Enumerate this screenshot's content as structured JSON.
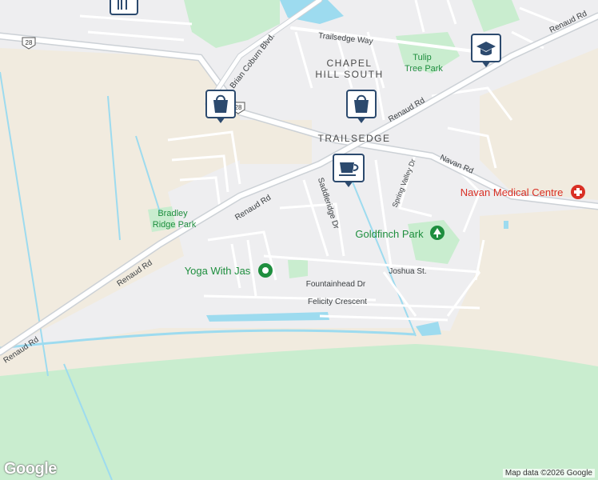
{
  "map": {
    "labels": {
      "neighbourhood_1": "CHAPEL",
      "neighbourhood_2": "HILL SOUTH",
      "trailsedge": "TRAILSEDGE",
      "trailsedge_way": "Trailsedge Way",
      "brian_coburn": "Brian Coburn Blvd.",
      "renaud_nw": "Renaud Rd",
      "renaud_center": "Renaud Rd",
      "renaud_mid": "Renaud Rd",
      "renaud_sw1": "Renaud Rd",
      "renaud_sw2": "Renaud Rd",
      "navan": "Navan Rd",
      "saddleridge": "Saddleridge Dr",
      "spring_valley": "Spring Valley Dr",
      "joshua": "Joshua St.",
      "fountainhead": "Fountainhead Dr",
      "felicity": "Felicity Crescent",
      "route_28_a": "28",
      "route_28_b": "28",
      "tulip_1": "Tulip",
      "tulip_2": "Tree Park",
      "bradley_1": "Bradley",
      "bradley_2": "Ridge Park",
      "goldfinch": "Goldfinch Park",
      "yoga": "Yoga With Jas",
      "navan_medical": "Navan Medical Centre"
    },
    "pins": {
      "restaurant": "restaurant-icon",
      "shopping_1": "shopping-bag-icon",
      "shopping_2": "shopping-bag-icon",
      "cafe": "coffee-cup-icon",
      "school": "school-icon"
    },
    "colors": {
      "water": "#9ddbef",
      "park": "#c9edcf",
      "park_label": "#1e8e3e",
      "medical": "#d93025",
      "pin": "#2c4a6e",
      "road_label": "#3c4043"
    }
  },
  "attribution": "Map data ©2026 Google",
  "logo": "Google"
}
